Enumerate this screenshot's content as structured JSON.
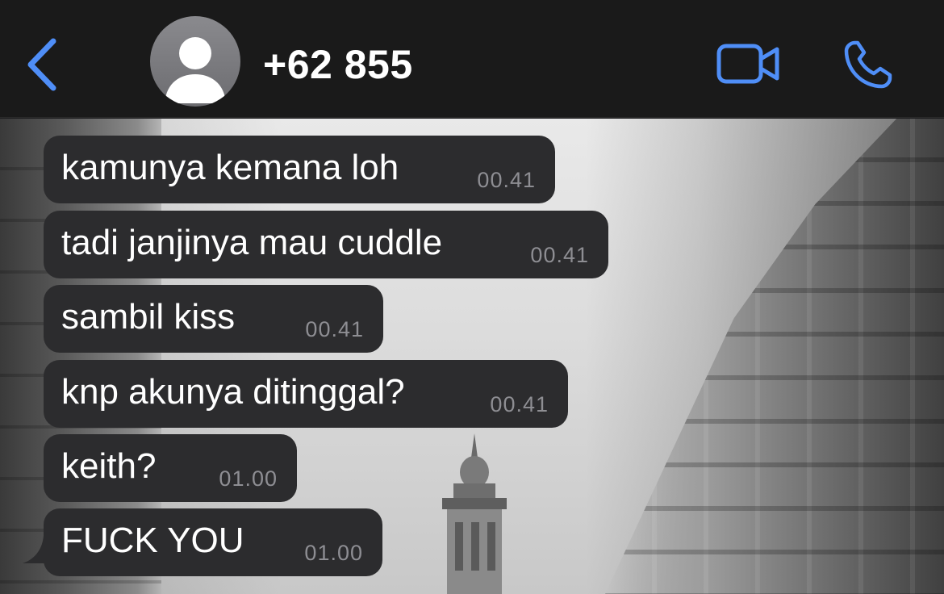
{
  "header": {
    "contact_name": "+62 855",
    "icons": {
      "back": "chevron-left-icon",
      "avatar": "person-silhouette-icon",
      "video": "video-camera-icon",
      "call": "phone-icon"
    },
    "accent_color": "#4f8ef7"
  },
  "messages": [
    {
      "text": "kamunya kemana loh",
      "time": "00.41"
    },
    {
      "text": "tadi janjinya mau cuddle",
      "time": "00.41"
    },
    {
      "text": "sambil kiss",
      "time": "00.41"
    },
    {
      "text": "knp akunya ditinggal?",
      "time": "00.41"
    },
    {
      "text": "keith?",
      "time": "01.00"
    },
    {
      "text": "FUCK YOU",
      "time": "01.00"
    }
  ],
  "colors": {
    "header_bg": "#1a1a1a",
    "bubble_bg": "#2c2c2e",
    "timestamp": "#8e8e93"
  }
}
